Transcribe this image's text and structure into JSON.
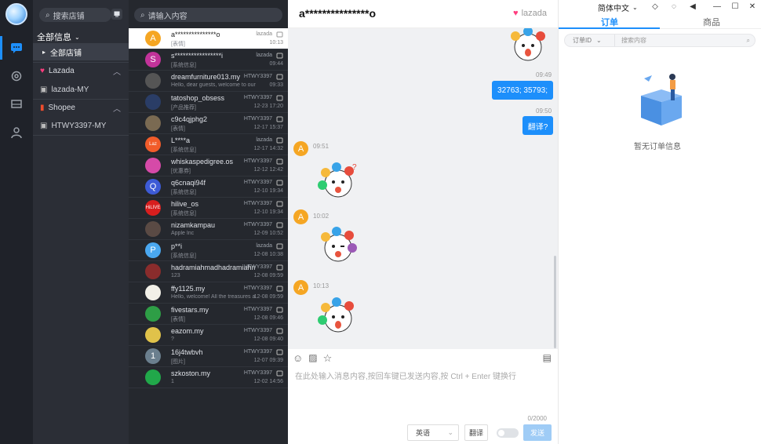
{
  "rail": {
    "items": [
      "chat-icon",
      "settings-icon",
      "store-icon",
      "user-icon"
    ]
  },
  "sidebar": {
    "search_placeholder": "搜索店铺",
    "all_info": "全部信息",
    "all_shops": "全部店铺",
    "groups": [
      {
        "label": "Lazada",
        "sub": "lazada-MY"
      },
      {
        "label": "Shopee",
        "sub": "HTWY3397-MY"
      }
    ]
  },
  "chatlist": {
    "search_placeholder": "请输入内容",
    "items": [
      {
        "name": "a***************o",
        "preview": "[表情]",
        "shop": "lazada",
        "time": "10:13",
        "av": "A",
        "color": "#f5a623",
        "sel": true
      },
      {
        "name": "s*****************i",
        "preview": "[系统信息]",
        "shop": "lazada",
        "time": "09:44",
        "av": "S",
        "color": "#c2339a"
      },
      {
        "name": "dreamfurniture013.my",
        "preview": "Hello, dear guests, welcome to our shop, y",
        "shop": "HTWY3397",
        "time": "09:33",
        "av": "",
        "color": "#555"
      },
      {
        "name": "tatoshop_obsess",
        "preview": "[产品推荐]",
        "shop": "HTWY3397",
        "time": "12-23 17:20",
        "av": "",
        "color": "#2a3d66"
      },
      {
        "name": "c9c4qjphg2",
        "preview": "[表情]",
        "shop": "HTWY3397",
        "time": "12-17 15:37",
        "av": "",
        "color": "#7a6a52"
      },
      {
        "name": "L****a",
        "preview": "[系统信息]",
        "shop": "lazada",
        "time": "12-17 14:32",
        "av": "Laz",
        "color": "#f25c2a"
      },
      {
        "name": "whiskaspedigree.os",
        "preview": "[优惠券]",
        "shop": "HTWY3397",
        "time": "12-12 12:42",
        "av": "",
        "color": "#d64aa8"
      },
      {
        "name": "q6cnaqi94f",
        "preview": "[系统信息]",
        "shop": "HTWY3397",
        "time": "12-10 19:34",
        "av": "Q",
        "color": "#3d5bd6"
      },
      {
        "name": "hilive_os",
        "preview": "[系统信息]",
        "shop": "HTWY3397",
        "time": "12-10 19:34",
        "av": "HiLIVE",
        "color": "#d81e1e"
      },
      {
        "name": "nizamkampau",
        "preview": "Apple Inc",
        "shop": "HTWY3397",
        "time": "12-09 10:52",
        "av": "",
        "color": "#5a4a44"
      },
      {
        "name": "p**i",
        "preview": "[系统信息]",
        "shop": "lazada",
        "time": "12-08 10:38",
        "av": "P",
        "color": "#4aa8f0"
      },
      {
        "name": "hadramiahmadhadramiahmad",
        "preview": "123",
        "shop": "HTWY3397",
        "time": "12-08 09:59",
        "av": "",
        "color": "#8a2c2c"
      },
      {
        "name": "ffy1125.my",
        "preview": "Hello, welcome! All the treasures are",
        "shop": "HTWY3397",
        "time": "12-08 09:59",
        "av": "",
        "color": "#f2f0e8"
      },
      {
        "name": "fivestars.my",
        "preview": "[表情]",
        "shop": "HTWY3397",
        "time": "12-08 09:46",
        "av": "",
        "color": "#2e9e46"
      },
      {
        "name": "eazom.my",
        "preview": "?",
        "shop": "HTWY3397",
        "time": "12-08 09:40",
        "av": "",
        "color": "#e0c24a"
      },
      {
        "name": "16j4twbvh",
        "preview": "[图片]",
        "shop": "HTWY3397",
        "time": "12-07 09:39",
        "av": "1",
        "color": "#6b7f8e"
      },
      {
        "name": "szkoston.my",
        "preview": "1",
        "shop": "HTWY3397",
        "time": "12-02 14:56",
        "av": "",
        "color": "#21a84a"
      }
    ]
  },
  "chat": {
    "title": "a***************o",
    "platform": "lazada",
    "messages": [
      {
        "time": "09:49",
        "text": "32763; 35793;"
      },
      {
        "time": "09:50",
        "text": "翻译?"
      },
      {
        "time": "09:51",
        "avatar": "A"
      },
      {
        "time": "10:02",
        "avatar": "A"
      },
      {
        "time": "10:13",
        "avatar": "A"
      }
    ],
    "composer": {
      "placeholder": "在此处输入消息内容,按回车键已发送内容,按 Ctrl + Enter 键换行",
      "counter": "0/2000",
      "language": "英语",
      "translate": "翻译",
      "send": "发送"
    }
  },
  "right": {
    "language": "简体中文",
    "tabs": [
      "订单",
      "商品"
    ],
    "filter_select": "订单ID",
    "filter_placeholder": "搜索内容",
    "empty": "暂无订单信息"
  },
  "colors": {
    "accent": "#1d8ffb",
    "rail": "#1f2229",
    "sidebar": "#2b2e36",
    "list": "#25282e"
  }
}
